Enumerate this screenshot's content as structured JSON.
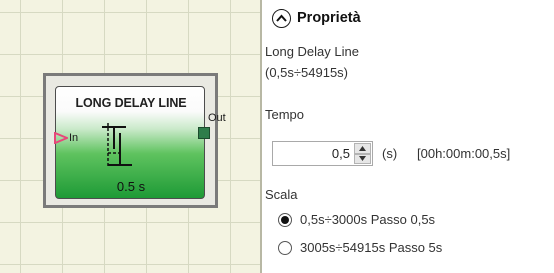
{
  "block": {
    "title": "LONG DELAY LINE",
    "input_label": "In",
    "output_label": "Out",
    "value": "0.5 s"
  },
  "panel": {
    "title": "Proprietà",
    "description": "Long Delay Line",
    "range": "(0,5s÷54915s)",
    "tempo": {
      "label": "Tempo",
      "value": "0,5",
      "unit": "(s)",
      "formatted": "[00h:00m:00,5s]"
    },
    "scala": {
      "label": "Scala",
      "options": [
        {
          "label": "0,5s÷3000s Passo 0,5s",
          "selected": true
        },
        {
          "label": "3005s÷54915s Passo 5s",
          "selected": false
        }
      ]
    }
  },
  "colors": {
    "canvas": "#f3f3e1",
    "grid": "#d6d9c2",
    "block_green": "#1e9a36",
    "input_arrow": "#e8467a",
    "output_port": "#2e7d4a"
  },
  "icons": {
    "collapse": "chevron-up-circle-icon",
    "spin_up": "triangle-up-icon",
    "spin_down": "triangle-down-icon"
  }
}
